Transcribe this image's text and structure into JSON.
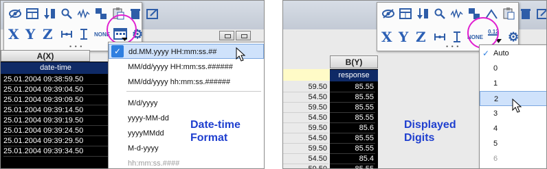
{
  "left": {
    "column_header": "A(X)",
    "sub_header": "date-time",
    "rows": [
      "25.01.2004 09:38:59.50",
      "25.01.2004 09:39:04.50",
      "25.01.2004 09:39:09.50",
      "25.01.2004 09:39:14.50",
      "25.01.2004 09:39:19.50",
      "25.01.2004 09:39:24.50",
      "25.01.2004 09:39:29.50",
      "25.01.2004 09:39:34.50"
    ],
    "menu_items": [
      {
        "label": "dd.MM.yyyy HH:mm:ss.##",
        "state": "selected"
      },
      {
        "label": "MM/dd/yyyy HH:mm:ss.######",
        "state": "normal"
      },
      {
        "label": "MM/dd/yyyy hh:mm:ss.######",
        "state": "normal"
      },
      {
        "label": "M/d/yyyy",
        "state": "normal"
      },
      {
        "label": "yyyy-MM-dd",
        "state": "normal"
      },
      {
        "label": "yyyyMMdd",
        "state": "normal"
      },
      {
        "label": "M-d-yyyy",
        "state": "normal"
      },
      {
        "label": "hh:mm:ss.####",
        "state": "dim"
      }
    ],
    "caption_line1": "Date-time",
    "caption_line2": "Format",
    "toolbar_none_label": "NONE"
  },
  "right": {
    "column_header": "B(Y)",
    "sub_header": "response",
    "left_partial": [
      "59.50",
      "54.50",
      "59.50",
      "54.50",
      "59.50",
      "54.50",
      "59.50",
      "54.50",
      "59.50"
    ],
    "rows": [
      "85.55",
      "85.55",
      "85.55",
      "85.55",
      "85.6",
      "85.55",
      "85.55",
      "85.4",
      "85.55"
    ],
    "menu_items": [
      {
        "label": "Auto",
        "state": "checked"
      },
      {
        "label": "0",
        "state": "normal"
      },
      {
        "label": "1",
        "state": "normal"
      },
      {
        "label": "2",
        "state": "selected"
      },
      {
        "label": "3",
        "state": "normal"
      },
      {
        "label": "4",
        "state": "normal"
      },
      {
        "label": "5",
        "state": "normal"
      },
      {
        "label": "6",
        "state": "dim"
      }
    ],
    "caption_line1": "Displayed",
    "caption_line2": "Digits",
    "toolbar_none_label": "NONE",
    "digits_icon_label": "0.12"
  },
  "colors": {
    "highlight_circle": "#e020d0",
    "caption": "#1f3fcf",
    "icon_blue": "#2e5da8",
    "menu_selected": "#cfe2fb"
  }
}
